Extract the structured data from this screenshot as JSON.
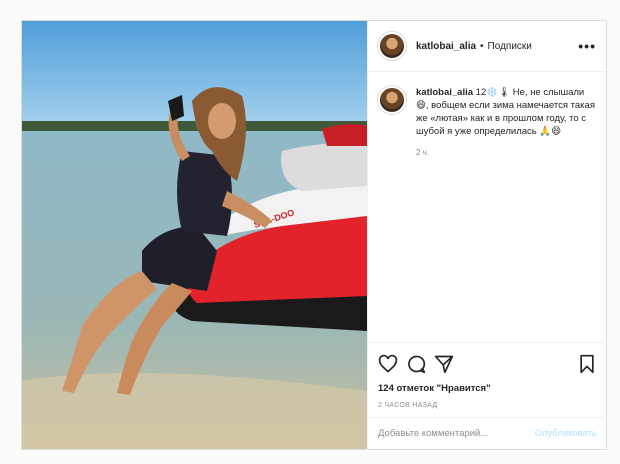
{
  "header": {
    "username": "katlobai_alia",
    "dot": "•",
    "follow_label": "Подписки",
    "more": "•••"
  },
  "caption": {
    "username": "katlobai_alia",
    "text": "12❄️🌡 Не, не слышали 😄, вобщем если зима намечается такая же «лютая» как и в прошлом году, то с шубой я уже определилась 🙏😄",
    "time": "2 ч."
  },
  "actions": {
    "likes": "124 отметок \"Нравится\"",
    "posted": "2 ЧАСОВ НАЗАД"
  },
  "comment_box": {
    "placeholder": "Добавьте комментарий...",
    "publish_label": "Опубликовать"
  },
  "photo": {
    "jetski_brand": "SEA-DOO"
  },
  "colors": {
    "link_disabled": "#b2dffc",
    "border": "#dbdbdb",
    "jetski_red": "#e2232b"
  }
}
